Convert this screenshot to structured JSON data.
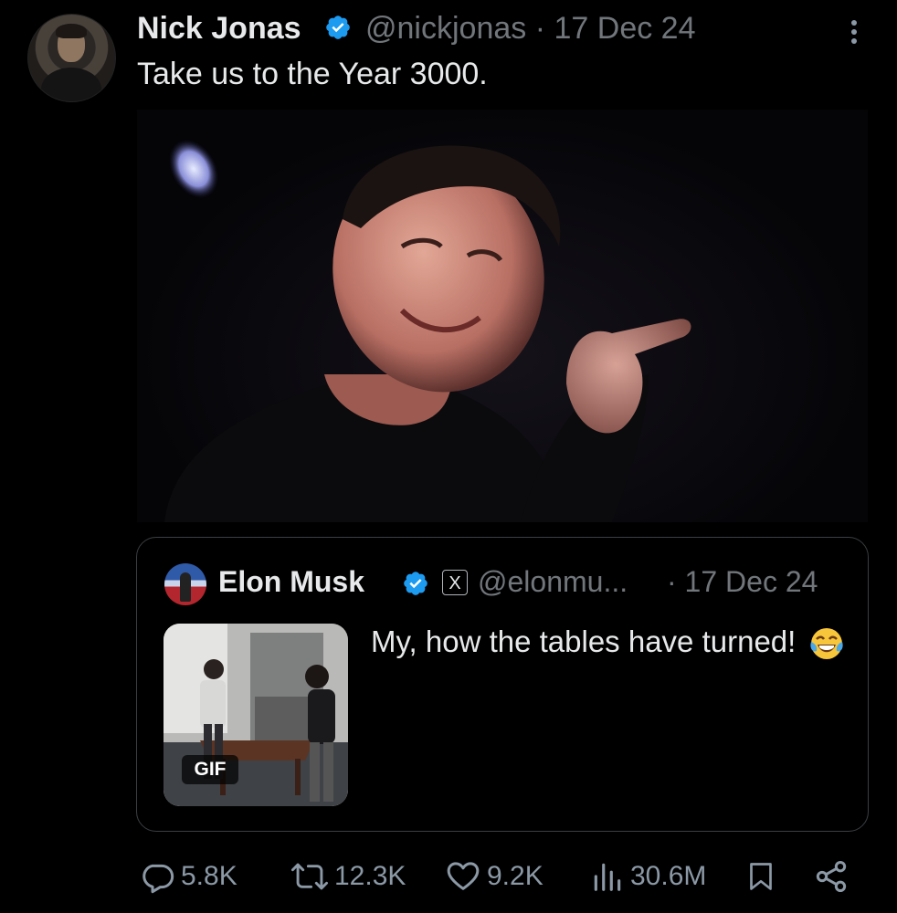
{
  "post": {
    "author_name": "Nick Jonas",
    "handle": "@nickjonas",
    "separator": "·",
    "date": "17 Dec 24",
    "text": "Take us to the Year 3000."
  },
  "quote": {
    "author_name": "Elon Musk",
    "affiliate_badge": "X",
    "handle": "@elonmu...",
    "date": "· 17 Dec 24",
    "text": "My, how the tables have turned!",
    "emoji": "face-with-tears-of-joy",
    "gif_label": "GIF"
  },
  "actions": {
    "replies": "5.8K",
    "reposts": "12.3K",
    "likes": "9.2K",
    "views": "30.6M"
  },
  "colors": {
    "background": "#000000",
    "primary_text": "#e7e9ea",
    "secondary_text": "#71767b",
    "verified_blue": "#1d9bf0",
    "border": "#3a3e42"
  },
  "icons": [
    "verified-badge-icon",
    "more-icon",
    "reply-icon",
    "repost-icon",
    "like-icon",
    "views-icon",
    "bookmark-icon",
    "share-icon"
  ]
}
